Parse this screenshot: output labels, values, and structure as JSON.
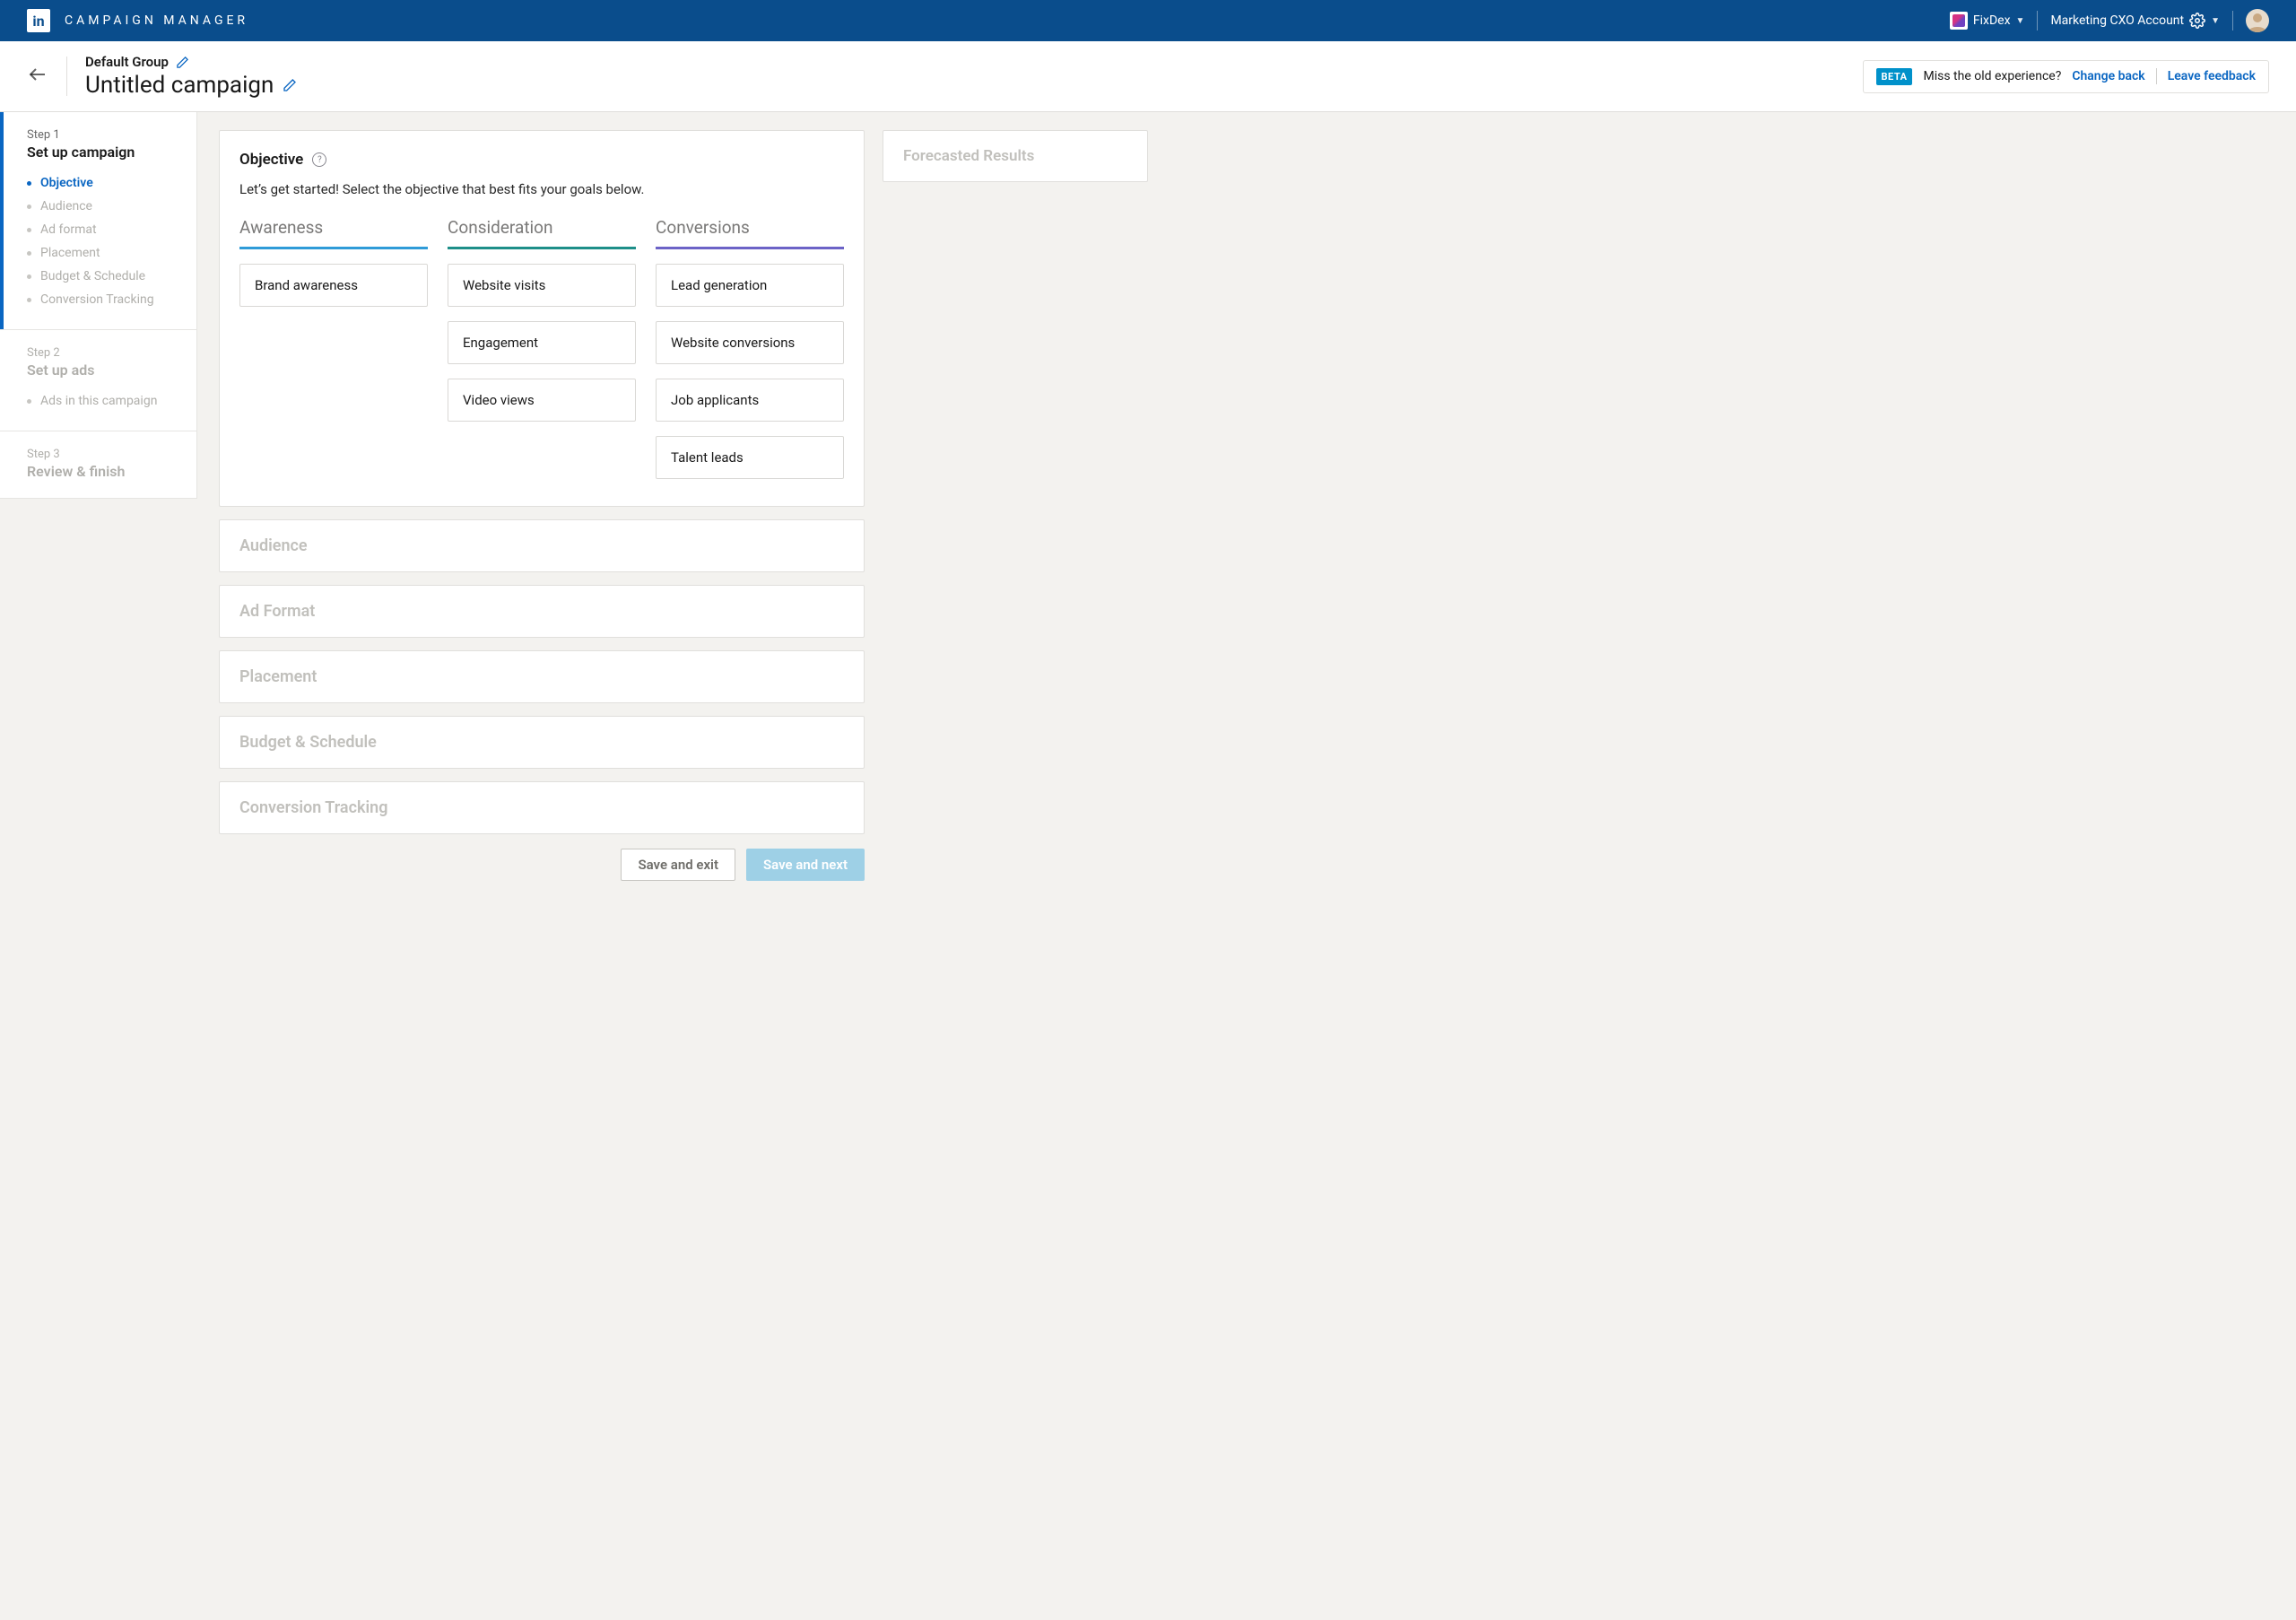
{
  "topbar": {
    "app_title": "CAMPAIGN MANAGER",
    "org_name": "FixDex",
    "account_name": "Marketing CXO Account"
  },
  "subheader": {
    "group_name": "Default Group",
    "campaign_name": "Untitled campaign",
    "beta_badge": "BETA",
    "beta_text": "Miss the old experience?",
    "change_back": "Change back",
    "leave_feedback": "Leave feedback"
  },
  "sidebar": {
    "step1_label": "Step 1",
    "step1_title": "Set up campaign",
    "step1_items": [
      "Objective",
      "Audience",
      "Ad format",
      "Placement",
      "Budget & Schedule",
      "Conversion Tracking"
    ],
    "step2_label": "Step 2",
    "step2_title": "Set up ads",
    "step2_items": [
      "Ads in this campaign"
    ],
    "step3_label": "Step 3",
    "step3_title": "Review & finish"
  },
  "objective": {
    "title": "Objective",
    "subtitle": "Let’s get started! Select the objective that best fits your goals below.",
    "columns": [
      {
        "heading": "Awareness",
        "color": "blue",
        "options": [
          "Brand awareness"
        ]
      },
      {
        "heading": "Consideration",
        "color": "teal",
        "options": [
          "Website visits",
          "Engagement",
          "Video views"
        ]
      },
      {
        "heading": "Conversions",
        "color": "purple",
        "options": [
          "Lead generation",
          "Website conversions",
          "Job applicants",
          "Talent leads"
        ]
      }
    ]
  },
  "sections": [
    "Audience",
    "Ad Format",
    "Placement",
    "Budget & Schedule",
    "Conversion Tracking"
  ],
  "right_panel": {
    "title": "Forecasted Results"
  },
  "footer": {
    "save_exit": "Save and exit",
    "save_next": "Save and next"
  }
}
